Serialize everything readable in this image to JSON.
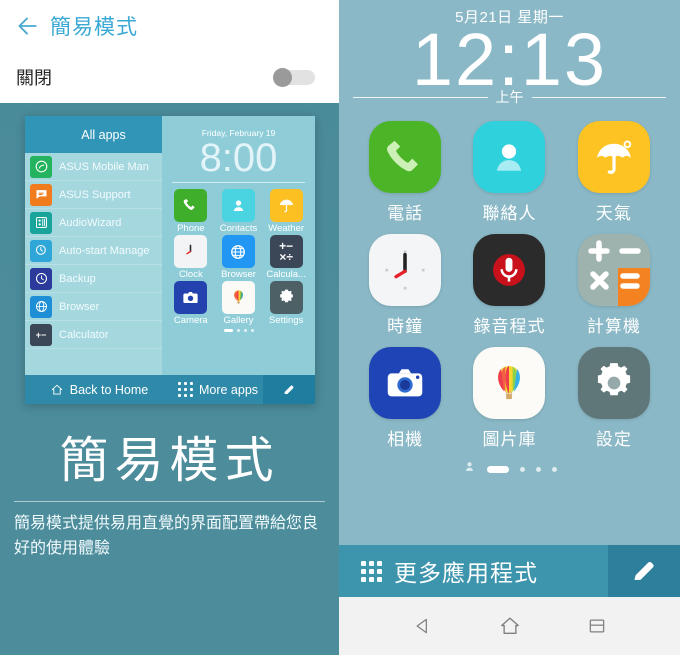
{
  "left_panel": {
    "header": {
      "back_icon": "arrow-left-icon",
      "title": "簡易模式"
    },
    "toggle": {
      "label": "關閉",
      "state": "off"
    },
    "preview": {
      "all_apps_title": "All apps",
      "app_list": [
        {
          "label": "ASUS Mobile Man",
          "color": "#24b35e",
          "glyph": "◎"
        },
        {
          "label": "ASUS Support",
          "color": "#f07c1e",
          "glyph": "◖"
        },
        {
          "label": "AudioWizard",
          "color": "#18a39b",
          "glyph": "▦"
        },
        {
          "label": "Auto-start Manage",
          "color": "#2fa6d8",
          "glyph": "◍"
        },
        {
          "label": "Backup",
          "color": "#2b3a9b",
          "glyph": "◉"
        },
        {
          "label": "Browser",
          "color": "#1e8fd6",
          "glyph": "✿"
        },
        {
          "label": "Calculator",
          "color": "#3b4656",
          "glyph": "+−"
        }
      ],
      "home": {
        "date": "Friday, February 19",
        "time": "8:00",
        "apps": [
          {
            "label": "Phone",
            "color": "#3fae2a",
            "icon": "phone-icon"
          },
          {
            "label": "Contacts",
            "color": "#4ad3e0",
            "icon": "contacts-icon"
          },
          {
            "label": "Weather",
            "color": "#fcc023",
            "icon": "umbrella-icon"
          },
          {
            "label": "Clock",
            "color": "#f2f4f5",
            "icon": "clock-icon"
          },
          {
            "label": "Browser",
            "color": "#2196f3",
            "icon": "globe-icon"
          },
          {
            "label": "Calcula...",
            "color": "#3b4656",
            "icon": "calculator-icon"
          },
          {
            "label": "Camera",
            "color": "#2342ae",
            "icon": "camera-icon"
          },
          {
            "label": "Gallery",
            "color": "#fbfaf6",
            "icon": "balloon-icon"
          },
          {
            "label": "Settings",
            "color": "#4d6066",
            "icon": "gear-icon"
          }
        ],
        "page_dots": 5,
        "active_dot": 1
      },
      "bottom_bar": {
        "back_home": "Back to Home",
        "back_home_icon": "home-icon",
        "more_apps": "More apps",
        "more_apps_icon": "grid-icon",
        "edit_icon": "pencil-icon"
      }
    },
    "hero_title": "簡易模式",
    "description": "簡易模式提供易用直覺的界面配置帶給您良好的使用體驗"
  },
  "right_panel": {
    "clock": {
      "date": "5月21日 星期一",
      "time": "12:13",
      "ampm": "上午"
    },
    "apps": [
      {
        "label": "電話",
        "icon": "phone-icon",
        "color": "#4cb527"
      },
      {
        "label": "聯絡人",
        "icon": "contacts-icon",
        "color": "#2fd1dd"
      },
      {
        "label": "天氣",
        "icon": "umbrella-icon",
        "color": "#fcc323"
      },
      {
        "label": "時鐘",
        "icon": "clock-icon",
        "color": "#f4f5f6"
      },
      {
        "label": "錄音程式",
        "icon": "microphone-icon",
        "color": "#2b2b2b"
      },
      {
        "label": "計算機",
        "icon": "calculator-icon",
        "color": "#9eb3ae"
      },
      {
        "label": "相機",
        "icon": "camera-icon",
        "color": "#1f44b5"
      },
      {
        "label": "圖片庫",
        "icon": "balloon-icon",
        "color": "#fcfbf7"
      },
      {
        "label": "設定",
        "icon": "gear-icon",
        "color": "#60777a"
      }
    ],
    "page_indicator": {
      "dots": 4,
      "active_index": 0,
      "has_person_icon": true,
      "person_icon": "person-icon"
    },
    "more_apps_bar": {
      "label": "更多應用程式",
      "grid_icon": "grid-icon",
      "edit_icon": "pencil-icon"
    },
    "navbar": {
      "back_icon": "nav-back-icon",
      "home_icon": "nav-home-icon",
      "recents_icon": "nav-recents-icon"
    }
  },
  "colors": {
    "accent_teal": "#3aa8d4",
    "panel_teal": "#4c8c9b",
    "home_bg": "#8ab8c6",
    "more_bar": "#3d95ad",
    "edit_bar": "#2d7f9b"
  }
}
